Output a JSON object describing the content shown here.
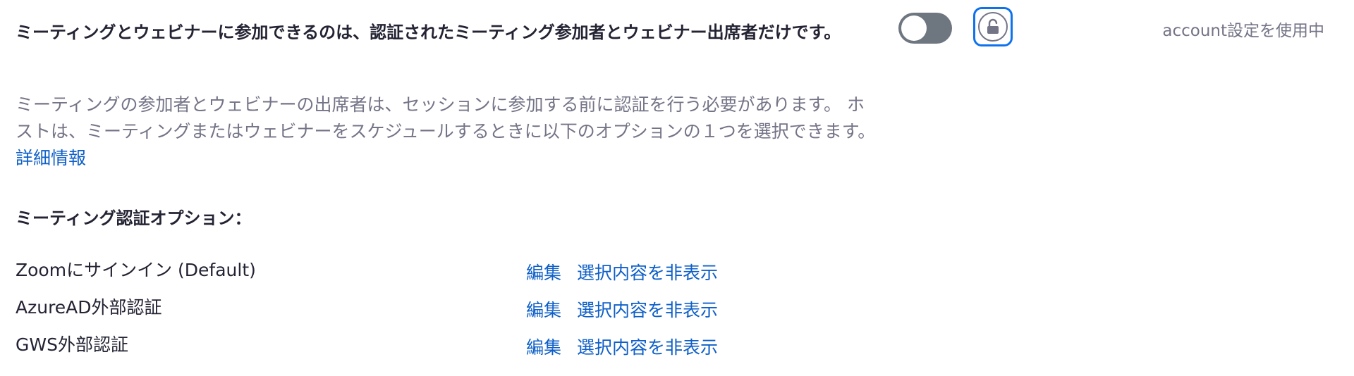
{
  "setting": {
    "title": "ミーティングとウェビナーに参加できるのは、認証されたミーティング参加者とウェビナー出席者だけです。",
    "description": "ミーティングの参加者とウェビナーの出席者は、セッションに参加する前に認証を行う必要があります。 ホストは、ミーティングまたはウェビナーをスケジュールするときに以下のオプションの１つを選択できます。",
    "learn_more": "詳細情報",
    "toggle_state": "off",
    "lock_icon": "unlock-icon",
    "status_text": "account設定を使用中"
  },
  "options_heading": "ミーティング認証オプション：",
  "options": [
    {
      "label": "Zoomにサインイン (Default)",
      "edit": "編集",
      "hide": "選択内容を非表示"
    },
    {
      "label": "AzureAD外部認証",
      "edit": "編集",
      "hide": "選択内容を非表示"
    },
    {
      "label": "GWS外部認証",
      "edit": "編集",
      "hide": "選択内容を非表示"
    }
  ],
  "colors": {
    "link": "#0e5fc8",
    "accent": "#0e72ed",
    "toggle_off": "#6e7680",
    "muted_text": "#747487"
  }
}
